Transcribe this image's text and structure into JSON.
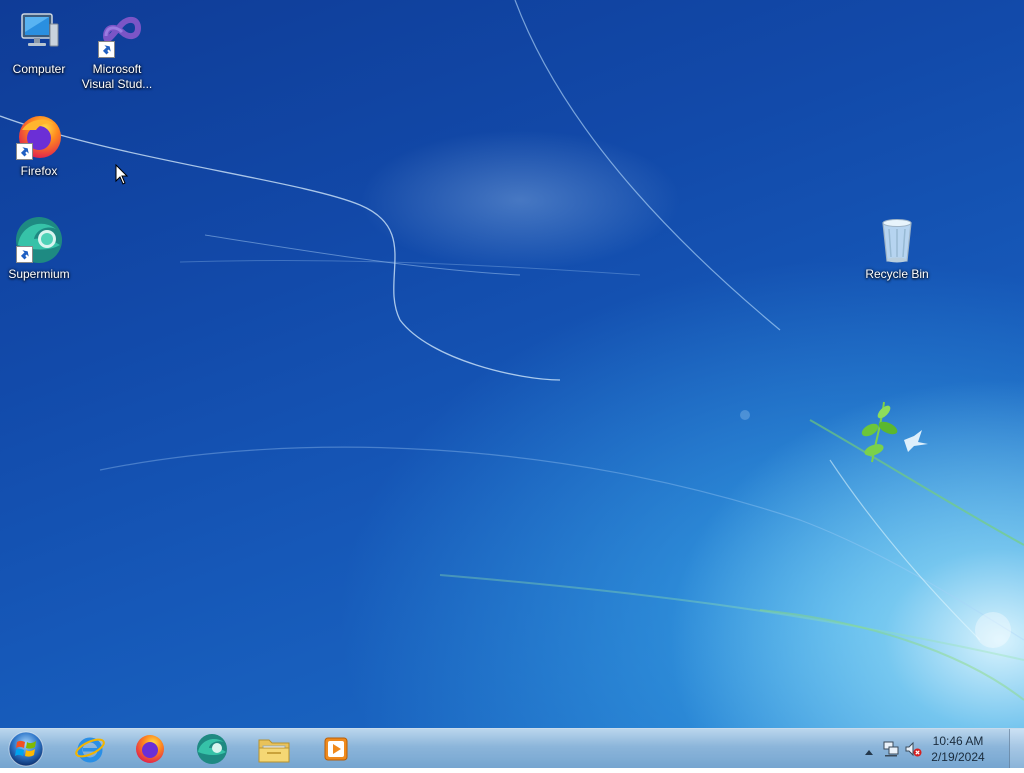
{
  "desktop": {
    "icons": [
      {
        "label": "Computer",
        "icon": "computer-icon"
      },
      {
        "label": "Microsoft\nVisual Stud...",
        "icon": "visual-studio-icon"
      },
      {
        "label": "Firefox",
        "icon": "firefox-icon"
      },
      {
        "label": "Supermium",
        "icon": "supermium-icon"
      },
      {
        "label": "Recycle Bin",
        "icon": "recycle-bin-icon"
      }
    ]
  },
  "taskbar": {
    "start": "windows-start-orb",
    "pinned": [
      {
        "name": "Internet Explorer",
        "icon": "internet-explorer-icon"
      },
      {
        "name": "Firefox",
        "icon": "firefox-icon"
      },
      {
        "name": "Supermium",
        "icon": "supermium-icon"
      },
      {
        "name": "Windows Explorer",
        "icon": "folder-icon"
      },
      {
        "name": "Windows Media Player",
        "icon": "media-player-icon"
      }
    ],
    "tray": {
      "icons": [
        "show-hidden-icons-arrow",
        "network-icon",
        "volume-muted-icon"
      ],
      "time": "10:46 AM",
      "date": "2/19/2024"
    }
  },
  "colors": {
    "wallpaper_dark": "#0f3c97",
    "wallpaper_light": "#8fd6f5",
    "taskbar": "#8fb8dc",
    "text": "#ffffff"
  }
}
